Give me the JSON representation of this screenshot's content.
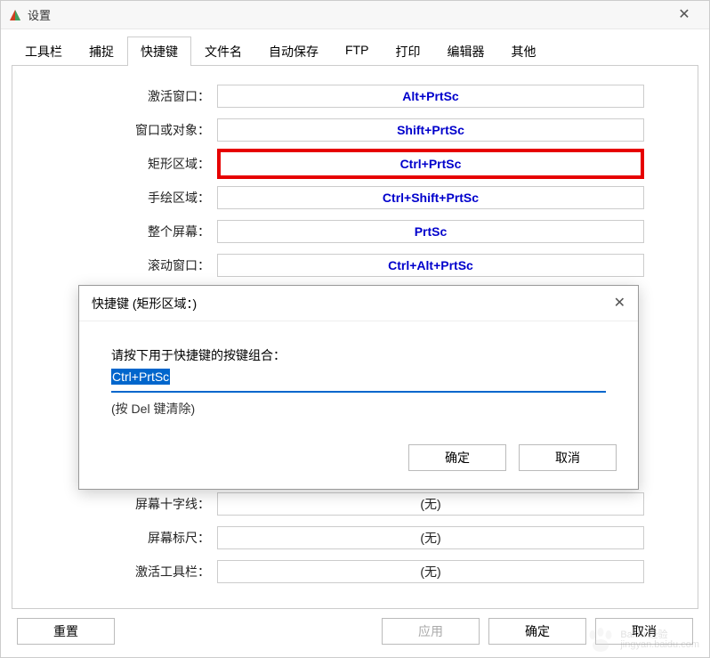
{
  "window": {
    "title": "设置"
  },
  "tabs": [
    {
      "label": "工具栏"
    },
    {
      "label": "捕捉"
    },
    {
      "label": "快捷键",
      "active": true
    },
    {
      "label": "文件名"
    },
    {
      "label": "自动保存"
    },
    {
      "label": "FTP"
    },
    {
      "label": "打印"
    },
    {
      "label": "编辑器"
    },
    {
      "label": "其他"
    }
  ],
  "shortcuts": [
    {
      "label": "激活窗口：",
      "value": "Alt+PrtSc"
    },
    {
      "label": "窗口或对象：",
      "value": "Shift+PrtSc"
    },
    {
      "label": "矩形区域：",
      "value": "Ctrl+PrtSc",
      "highlighted": true
    },
    {
      "label": "手绘区域：",
      "value": "Ctrl+Shift+PrtSc"
    },
    {
      "label": "整个屏幕：",
      "value": "PrtSc"
    },
    {
      "label": "滚动窗口：",
      "value": "Ctrl+Alt+PrtSc"
    }
  ],
  "shortcuts_bottom": [
    {
      "label": "屏幕十字线：",
      "value": "(无)"
    },
    {
      "label": "屏幕标尺：",
      "value": "(无)"
    },
    {
      "label": "激活工具栏：",
      "value": "(无)"
    }
  ],
  "dialog": {
    "title": "快捷键 (矩形区域：)",
    "prompt": "请按下用于快捷键的按键组合：",
    "value": "Ctrl+PrtSc",
    "hint": "(按 Del 键清除)",
    "ok": "确定",
    "cancel": "取消"
  },
  "buttons": {
    "reset": "重置",
    "apply": "应用",
    "ok": "确定",
    "cancel": "取消"
  },
  "watermark": {
    "brand": "Baidu 经验",
    "url": "jingyan.baidu.com"
  }
}
